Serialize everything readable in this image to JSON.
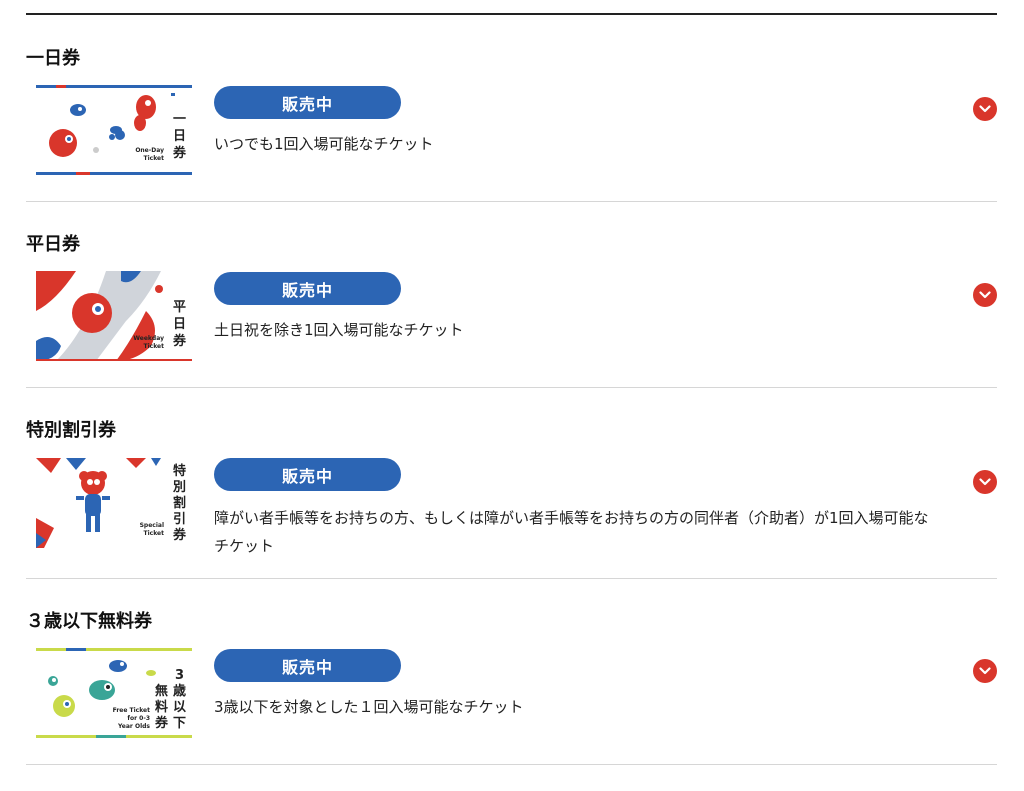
{
  "colors": {
    "accent_blue": "#2c65b4",
    "accent_red": "#d9362b"
  },
  "tickets": [
    {
      "title": "一日券",
      "status": "販売中",
      "description": "いつでも1回入場可能なチケット",
      "thumb_kanji": [
        "一",
        "日",
        "券"
      ],
      "thumb_en": [
        "One-Day",
        "Ticket"
      ]
    },
    {
      "title": "平日券",
      "status": "販売中",
      "description": "土日祝を除き1回入場可能なチケット",
      "thumb_kanji": [
        "平",
        "日",
        "券"
      ],
      "thumb_en": [
        "Weekday",
        "Ticket"
      ]
    },
    {
      "title": "特別割引券",
      "status": "販売中",
      "description": "障がい者手帳等をお持ちの方、もしくは障がい者手帳等をお持ちの方の同伴者（介助者）が1回入場可能なチケット",
      "thumb_kanji": [
        "特",
        "別",
        "割",
        "引",
        "券"
      ],
      "thumb_en": [
        "Special",
        "Ticket"
      ]
    },
    {
      "title": "３歳以下無料券",
      "status": "販売中",
      "description": "3歳以下を対象とした１回入場可能なチケット",
      "thumb_kanji": [
        "3",
        "歳",
        "以",
        "下",
        "無",
        "料",
        "券"
      ],
      "thumb_en": [
        "Free Ticket",
        "for 0-3",
        "Year Olds"
      ]
    }
  ]
}
